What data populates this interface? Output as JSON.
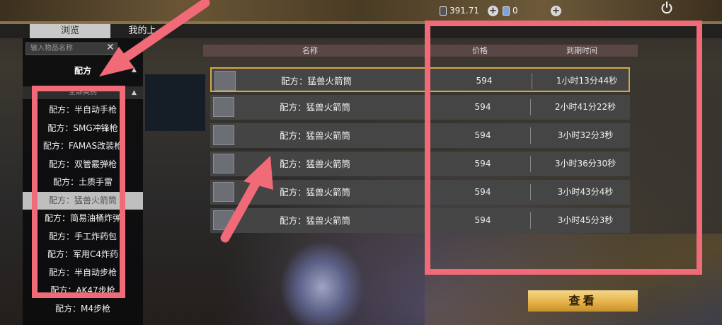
{
  "header": {
    "currency_amount": "391.71",
    "ticket_amount": "0",
    "plus_symbol": "+"
  },
  "tabs": [
    {
      "label": "浏览",
      "active": true
    },
    {
      "label": "我的上",
      "active": false
    }
  ],
  "sidebar": {
    "search_placeholder": "输入物品名称",
    "clear_symbol": "✕",
    "category_label": "配方",
    "subcategory_label": "全部类别",
    "collapse_symbol": "▲",
    "items": [
      {
        "label": "配方：半自动手枪"
      },
      {
        "label": "配方：SMG冲锋枪"
      },
      {
        "label": "配方：FAMAS改装枪"
      },
      {
        "label": "配方：双管霰弹枪"
      },
      {
        "label": "配方：土质手雷"
      },
      {
        "label": "配方：猛兽火箭筒",
        "selected": true
      },
      {
        "label": "配方：简易油桶炸弹"
      },
      {
        "label": "配方：手工炸药包"
      },
      {
        "label": "配方：军用C4炸药"
      },
      {
        "label": "配方：半自动步枪"
      },
      {
        "label": "配方：AK47步枪"
      },
      {
        "label": "配方：M4步枪"
      }
    ]
  },
  "table": {
    "columns": {
      "name": "名称",
      "price": "价格",
      "expire": "到期时间"
    },
    "rows": [
      {
        "name": "配方：猛兽火箭筒",
        "price": "594",
        "expire": "1小时13分44秒"
      },
      {
        "name": "配方：猛兽火箭筒",
        "price": "594",
        "expire": "2小时41分22秒"
      },
      {
        "name": "配方：猛兽火箭筒",
        "price": "594",
        "expire": "3小时32分3秒"
      },
      {
        "name": "配方：猛兽火箭筒",
        "price": "594",
        "expire": "3小时36分30秒"
      },
      {
        "name": "配方：猛兽火箭筒",
        "price": "594",
        "expire": "3小时43分4秒"
      },
      {
        "name": "配方：猛兽火箭筒",
        "price": "594",
        "expire": "3小时45分3秒"
      }
    ]
  },
  "actions": {
    "view_label": "查看"
  },
  "colors": {
    "annotation": "#f16a77",
    "accent_gold": "#e6b24a",
    "selected_border": "#d8a54a"
  }
}
